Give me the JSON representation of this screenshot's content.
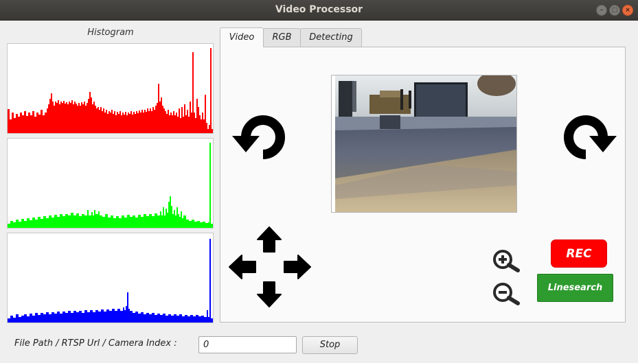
{
  "window": {
    "title": "Video Processor",
    "minimize_icon": "minimize-icon",
    "maximize_icon": "maximize-icon",
    "close_icon": "close-icon"
  },
  "histogram": {
    "label": "Histogram",
    "colors": {
      "red": "#ff0000",
      "green": "#00ff00",
      "blue": "#0000ff"
    }
  },
  "tabs": [
    {
      "label": "Video",
      "active": true
    },
    {
      "label": "RGB",
      "active": false
    },
    {
      "label": "Detecting",
      "active": false
    }
  ],
  "video_tab": {
    "rotate_left_icon": "rotate-counterclockwise-icon",
    "rotate_right_icon": "rotate-clockwise-icon",
    "pan_icons": [
      "arrow-up-icon",
      "arrow-left-icon",
      "arrow-right-icon",
      "arrow-down-icon"
    ],
    "zoom_in_icon": "zoom-in-icon",
    "zoom_out_icon": "zoom-out-icon",
    "rec_label": "REC",
    "rec_color": "#ff0000",
    "linesearch_label": "Linesearch",
    "linesearch_color": "#2e9b2e"
  },
  "source": {
    "label": "File Path / RTSP Url / Camera Index :",
    "value": "0",
    "stop_label": "Stop"
  }
}
